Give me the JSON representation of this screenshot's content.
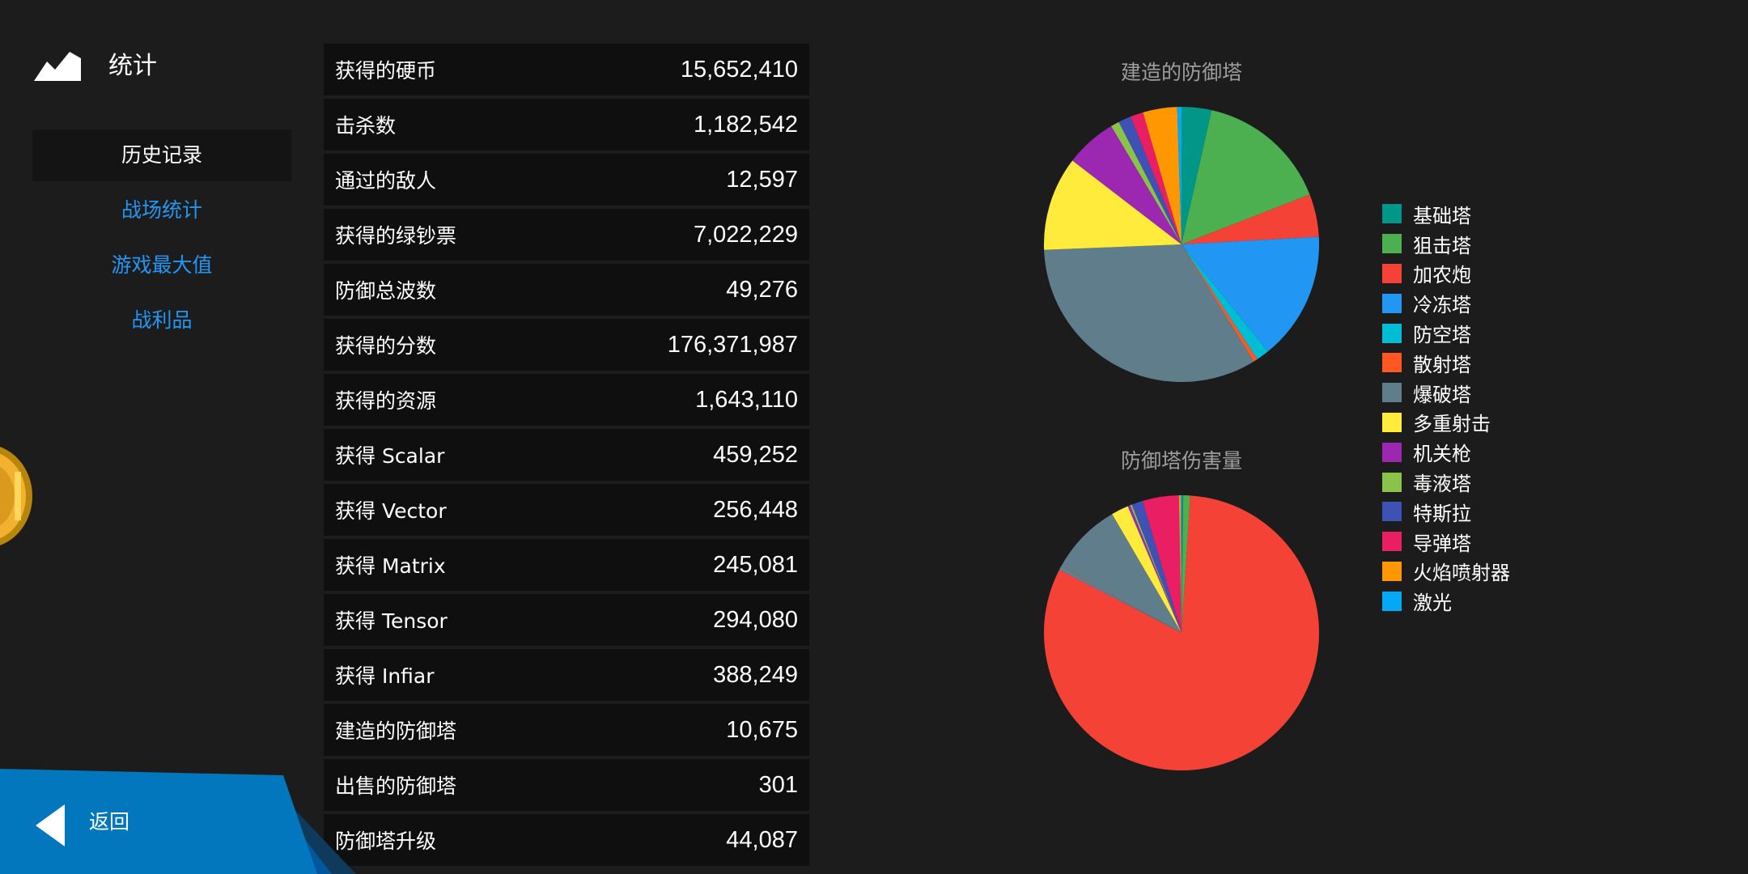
{
  "header": {
    "title": "统计",
    "icon": "mountain-icon"
  },
  "nav": {
    "items": [
      {
        "label": "历史记录",
        "active": true
      },
      {
        "label": "战场统计",
        "active": false
      },
      {
        "label": "游戏最大值",
        "active": false
      },
      {
        "label": "战利品",
        "active": false
      }
    ]
  },
  "stats": [
    {
      "label": "获得的硬币",
      "value": "15,652,410"
    },
    {
      "label": "击杀数",
      "value": "1,182,542"
    },
    {
      "label": "通过的敌人",
      "value": "12,597"
    },
    {
      "label": "获得的绿钞票",
      "value": "7,022,229"
    },
    {
      "label": "防御总波数",
      "value": "49,276"
    },
    {
      "label": "获得的分数",
      "value": "176,371,987"
    },
    {
      "label": "获得的资源",
      "value": "1,643,110"
    },
    {
      "label": "获得 Scalar",
      "value": "459,252"
    },
    {
      "label": "获得 Vector",
      "value": "256,448"
    },
    {
      "label": "获得 Matrix",
      "value": "245,081"
    },
    {
      "label": "获得 Tensor",
      "value": "294,080"
    },
    {
      "label": "获得 Infiar",
      "value": "388,249"
    },
    {
      "label": "建造的防御塔",
      "value": "10,675"
    },
    {
      "label": "出售的防御塔",
      "value": "301"
    },
    {
      "label": "防御塔升级",
      "value": "44,087"
    }
  ],
  "back_button": {
    "label": "返回",
    "icon": "back-arrow-icon"
  },
  "colors": {
    "background": "#1c1c1c",
    "row_background": "#0f0f0f",
    "active_nav_background": "#141414",
    "nav_link": "#2196f3",
    "back_button": "#0277bd",
    "chart_title": "#9e9e9e"
  },
  "chart_data": [
    {
      "type": "pie",
      "title": "建造的防御塔",
      "categories": [
        "基础塔",
        "狙击塔",
        "加农炮",
        "冷冻塔",
        "防空塔",
        "散射塔",
        "爆破塔",
        "多重射击",
        "机关枪",
        "毒液塔",
        "特斯拉",
        "导弹塔",
        "火焰喷射器",
        "激光"
      ],
      "values": [
        3.5,
        15.5,
        5.0,
        15.0,
        1.5,
        0.5,
        33.0,
        11.0,
        6.0,
        1.0,
        1.5,
        1.5,
        4.0,
        0.5
      ],
      "colors": [
        "#009688",
        "#4caf50",
        "#f44336",
        "#2196f3",
        "#00bcd4",
        "#ff5722",
        "#607d8b",
        "#ffeb3b",
        "#9c27b0",
        "#8bc34a",
        "#3f51b5",
        "#e91e63",
        "#ff9800",
        "#03a9f4"
      ],
      "legend": "right"
    },
    {
      "type": "pie",
      "title": "防御塔伤害量",
      "categories": [
        "基础塔",
        "狙击塔",
        "加农炮",
        "冷冻塔",
        "防空塔",
        "散射塔",
        "爆破塔",
        "多重射击",
        "机关枪",
        "毒液塔",
        "特斯拉",
        "导弹塔",
        "火焰喷射器",
        "激光"
      ],
      "values": [
        0.2,
        0.8,
        80.5,
        0.1,
        0.1,
        0.1,
        8.5,
        2.0,
        0.3,
        0.2,
        1.3,
        4.2,
        0.2,
        0.1
      ],
      "colors": [
        "#009688",
        "#4caf50",
        "#f44336",
        "#2196f3",
        "#00bcd4",
        "#ff5722",
        "#607d8b",
        "#ffeb3b",
        "#9c27b0",
        "#8bc34a",
        "#3f51b5",
        "#e91e63",
        "#ff9800",
        "#03a9f4"
      ],
      "legend": "right"
    }
  ]
}
